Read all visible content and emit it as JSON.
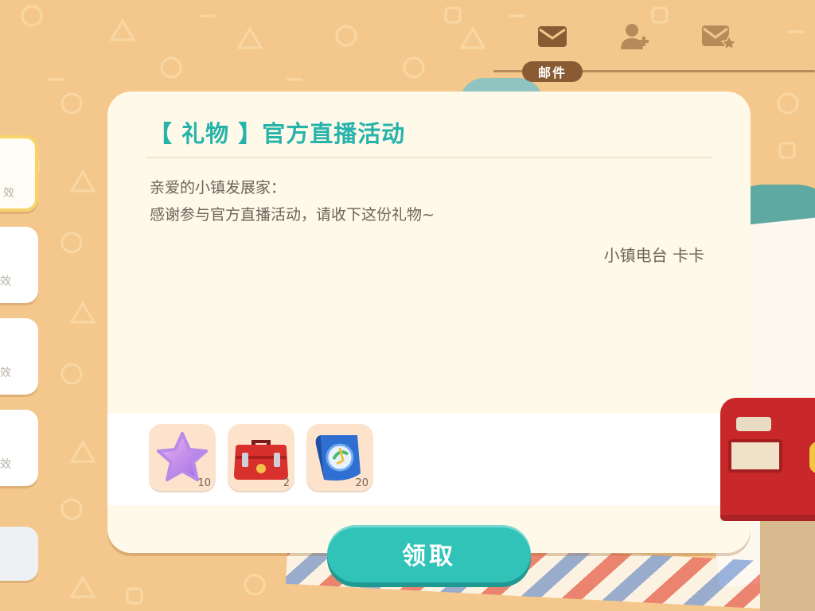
{
  "colors": {
    "background": "#f4c88c",
    "accent": "#25b3aa",
    "button": "#31c3b8",
    "tab": "#8a5a33",
    "card": "#fff9ea"
  },
  "header": {
    "icons": [
      "mail-icon",
      "add-friend-icon",
      "starred-mail-icon"
    ],
    "tab_label": "邮件"
  },
  "sidebar": {
    "items": [
      {
        "stub": "效",
        "selected": true
      },
      {
        "stub": "效",
        "selected": false
      },
      {
        "stub": "效",
        "selected": false
      },
      {
        "stub": "效",
        "selected": false
      },
      {
        "stub": "",
        "selected": false
      }
    ]
  },
  "mail": {
    "title": "【 礼物 】官方直播活动",
    "greeting": "亲爱的小镇发展家：",
    "body": "感谢参与官方直播活动，请收下这份礼物~",
    "signature": "小镇电台  卡卡",
    "rewards": [
      {
        "icon": "purple-star-icon",
        "count": "10"
      },
      {
        "icon": "red-toolbox-icon",
        "count": "2"
      },
      {
        "icon": "blue-map-scroll-icon",
        "count": "20"
      }
    ],
    "claim_label": "领取"
  }
}
